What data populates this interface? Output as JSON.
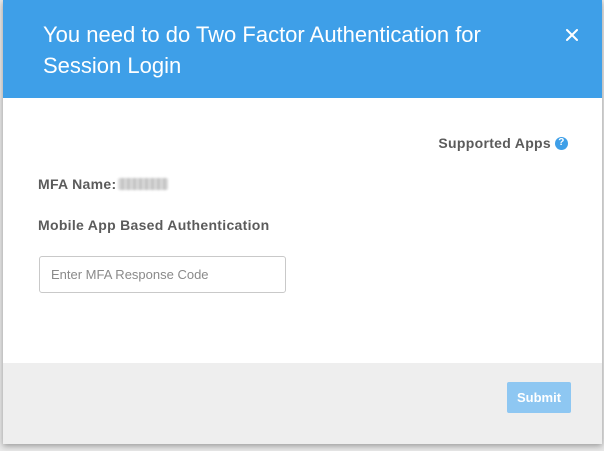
{
  "modal": {
    "title": "You need to do Two Factor Authentication for Session Login",
    "close_icon": "close-icon",
    "close_glyph": "×"
  },
  "body": {
    "supported_apps_label": "Supported Apps",
    "help_icon": "help-icon",
    "help_glyph": "?",
    "mfa_name_label": "MFA Name:",
    "mfa_name_value": "",
    "auth_heading": "Mobile App Based Authentication",
    "response_input": {
      "placeholder": "Enter MFA Response Code",
      "value": ""
    }
  },
  "footer": {
    "submit_label": "Submit"
  },
  "colors": {
    "header": "#3e9fe8",
    "submit_disabled": "#8ec7f2",
    "footer": "#eeeeee",
    "label_text": "#5b5b5b"
  }
}
